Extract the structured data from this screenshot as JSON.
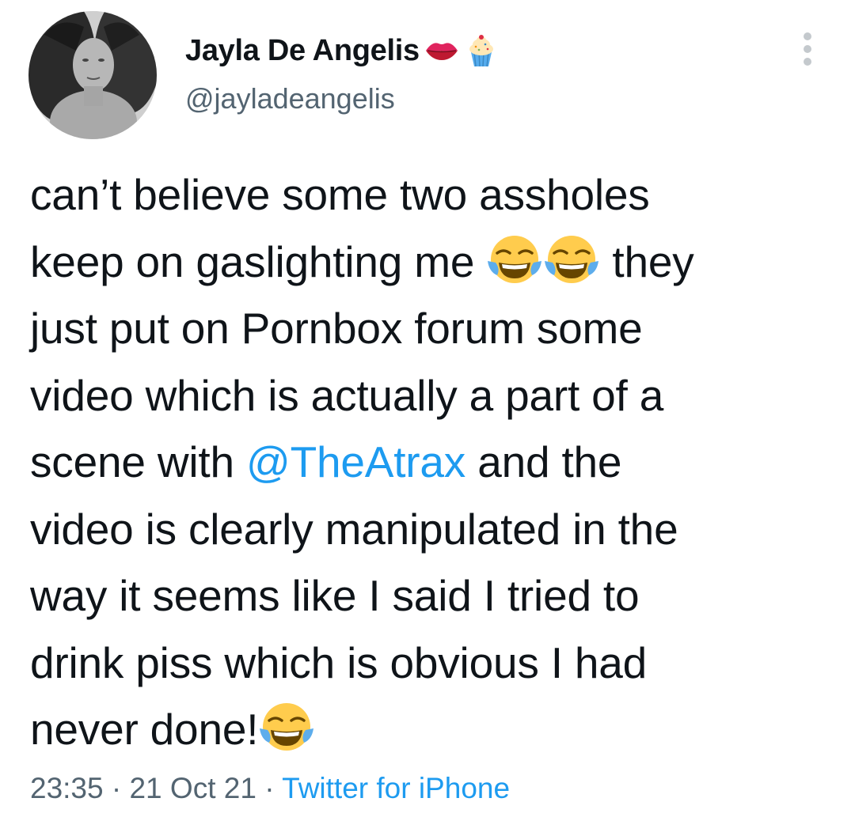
{
  "author": {
    "display_name": "Jayla De Angelis",
    "handle": "@jayladeangelis",
    "name_emojis": [
      "lips-emoji",
      "cupcake-emoji"
    ]
  },
  "tweet": {
    "line1": "can’t believe some two assholes",
    "line2_a": "keep on gaslighting me ",
    "line2_b": " they",
    "line3": "just put on Pornbox forum some",
    "line4": "video which is actually a part of a",
    "line5_a": "scene with ",
    "mention": "@TheAtrax",
    "line5_b": " and the",
    "line6": "video is clearly manipulated in the",
    "line7": "way it seems like I said I tried to",
    "line8": "drink piss which is obvious I had",
    "line9": "never done!",
    "inline_emoji": "face-with-tears-of-joy-emoji"
  },
  "meta": {
    "time": "23:35",
    "sep1": " · ",
    "date": "21 Oct 21",
    "sep2": " · ",
    "source": "Twitter for iPhone"
  },
  "colors": {
    "text": "#0f1419",
    "secondary": "#536471",
    "link": "#1d9bf0"
  }
}
